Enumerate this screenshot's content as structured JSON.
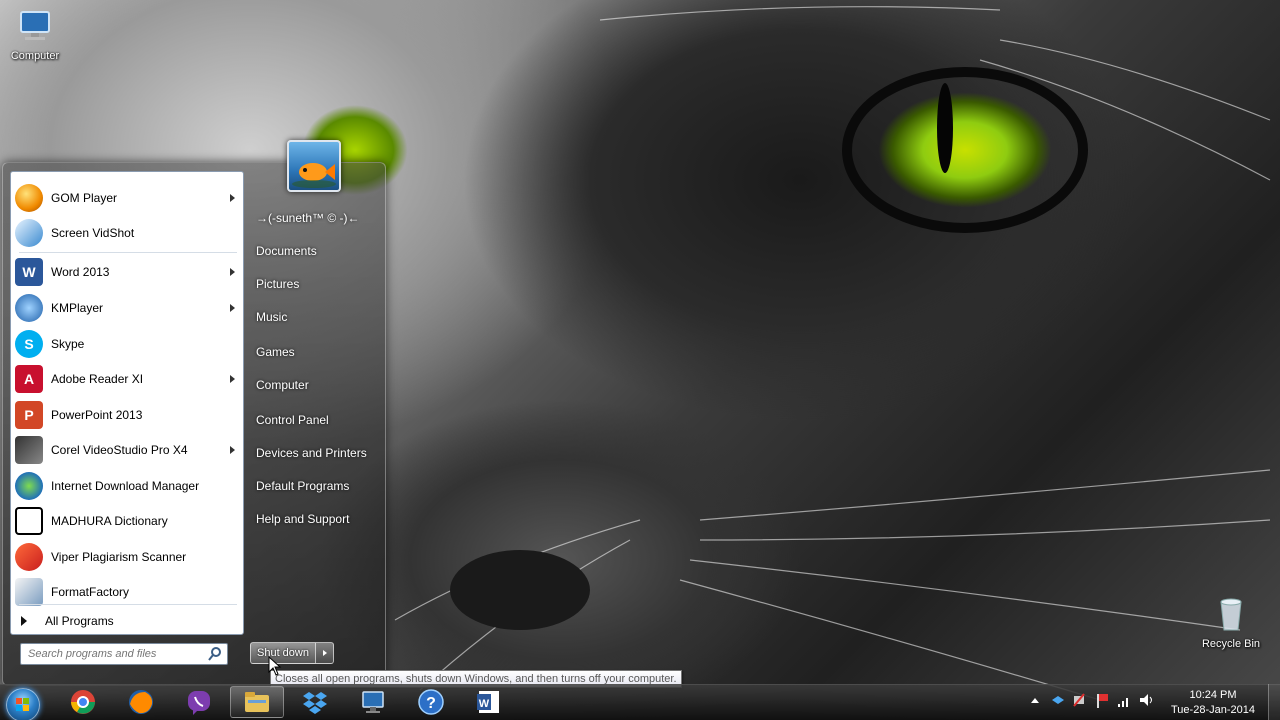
{
  "desktop": {
    "icons": [
      {
        "label": "Computer"
      },
      {
        "label": "Recycle Bin"
      }
    ]
  },
  "start_menu": {
    "programs": [
      {
        "label": "GOM Player",
        "has_submenu": true,
        "icon": "gom-player-icon"
      },
      {
        "label": "Screen VidShot",
        "has_submenu": false,
        "icon": "screen-vidshot-icon"
      },
      {
        "label": "Word 2013",
        "has_submenu": true,
        "icon": "word-icon"
      },
      {
        "label": "KMPlayer",
        "has_submenu": true,
        "icon": "kmplayer-icon"
      },
      {
        "label": "Skype",
        "has_submenu": false,
        "icon": "skype-icon"
      },
      {
        "label": "Adobe Reader XI",
        "has_submenu": true,
        "icon": "adobe-reader-icon"
      },
      {
        "label": "PowerPoint 2013",
        "has_submenu": false,
        "icon": "powerpoint-icon"
      },
      {
        "label": "Corel VideoStudio Pro X4",
        "has_submenu": true,
        "icon": "corel-videostudio-icon"
      },
      {
        "label": "Internet Download Manager",
        "has_submenu": false,
        "icon": "idm-icon"
      },
      {
        "label": "MADHURA Dictionary",
        "has_submenu": false,
        "icon": "madhura-dictionary-icon"
      },
      {
        "label": "Viper Plagiarism Scanner",
        "has_submenu": false,
        "icon": "viper-icon"
      },
      {
        "label": "FormatFactory",
        "has_submenu": false,
        "icon": "formatfactory-icon"
      }
    ],
    "all_programs": "All Programs",
    "search_placeholder": "Search programs and files",
    "right_items": [
      "→(-suneth™ © -)←",
      "Documents",
      "Pictures",
      "Music",
      "Games",
      "Computer",
      "Control Panel",
      "Devices and Printers",
      "Default Programs",
      "Help and Support"
    ],
    "shutdown_label": "Shut down",
    "tooltip": "Closes all open programs, shuts down Windows, and then turns off your computer."
  },
  "taskbar": {
    "pinned": [
      "chrome-icon",
      "firefox-icon",
      "viber-icon",
      "explorer-icon",
      "dropbox-icon",
      "remote-desktop-icon",
      "help-icon",
      "word-icon"
    ],
    "clock_time": "10:24 PM",
    "clock_date": "Tue-28-Jan-2014"
  },
  "colors": {
    "accent": "#2c7fc7",
    "cat_eye": "#8fcc10"
  }
}
